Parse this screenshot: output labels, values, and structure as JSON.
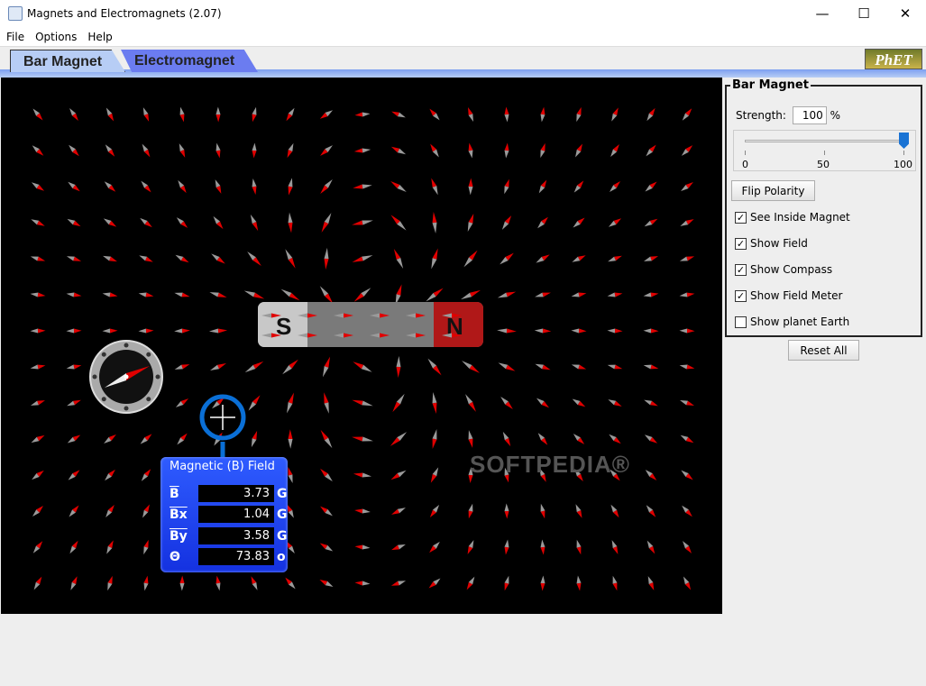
{
  "window": {
    "title": "Magnets and Electromagnets (2.07)",
    "minimize": "—",
    "maximize": "☐",
    "close": "✕"
  },
  "menu": [
    "File",
    "Options",
    "Help"
  ],
  "tabs": [
    {
      "label": "Bar Magnet",
      "active": true
    },
    {
      "label": "Electromagnet",
      "active": false
    }
  ],
  "logo": "PhET",
  "magnet": {
    "south": "S",
    "north": "N",
    "colors": {
      "south": "#c8c8c8",
      "body": "#7a7a7a",
      "north": "#b01818"
    }
  },
  "field_meter": {
    "title": "Magnetic (B) Field",
    "rows": [
      {
        "label": "B",
        "value": "3.73",
        "unit": "G"
      },
      {
        "label": "Bx",
        "value": "1.04",
        "unit": "G"
      },
      {
        "label": "By",
        "value": "3.58",
        "unit": "G"
      },
      {
        "label": "Θ",
        "value": "73.83",
        "unit": "o"
      }
    ]
  },
  "watermark": "SOFTPEDIA®",
  "panel": {
    "title": "Bar Magnet",
    "strength_label": "Strength:",
    "strength_value": "100",
    "strength_unit": "%",
    "slider": {
      "value": 100,
      "min": 0,
      "max": 100,
      "ticks": [
        "0",
        "50",
        "100"
      ]
    },
    "flip_button": "Flip Polarity",
    "checkboxes": [
      {
        "label": "See Inside Magnet",
        "checked": true
      },
      {
        "label": "Show Field",
        "checked": true
      },
      {
        "label": "Show Compass",
        "checked": true
      },
      {
        "label": "Show Field Meter",
        "checked": true
      },
      {
        "label": "Show planet Earth",
        "checked": false
      }
    ]
  },
  "reset_button": "Reset All",
  "colors": {
    "needle_north": "#e00000",
    "needle_south": "#9a9a9a",
    "meter": "#2244ff",
    "tab_active": "#b7cdf5",
    "tab_inactive": "#6b7cf0"
  }
}
